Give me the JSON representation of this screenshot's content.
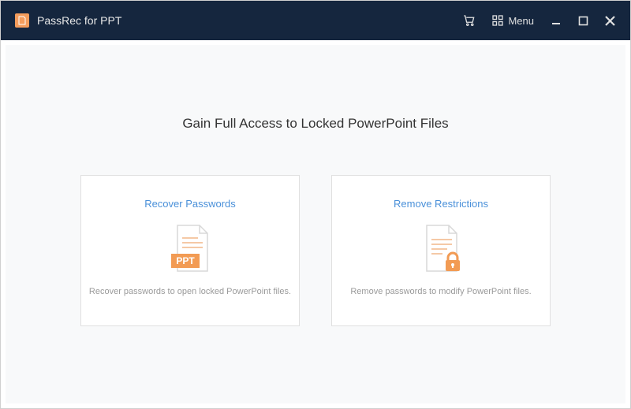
{
  "titlebar": {
    "app_title": "PassRec for PPT",
    "menu_label": "Menu"
  },
  "main": {
    "heading": "Gain Full Access to Locked PowerPoint Files"
  },
  "cards": {
    "recover": {
      "title": "Recover Passwords",
      "desc": "Recover passwords to open locked PowerPoint files.",
      "badge": "PPT"
    },
    "remove": {
      "title": "Remove Restrictions",
      "desc": "Remove passwords to modify PowerPoint files."
    }
  }
}
